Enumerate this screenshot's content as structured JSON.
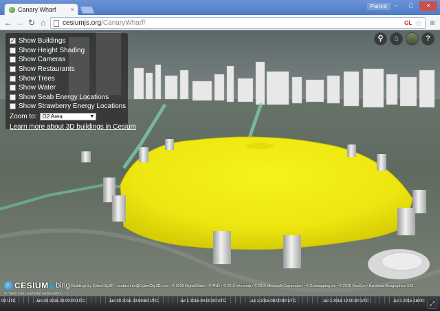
{
  "browser": {
    "tab_title": "Canary Wharf",
    "tab_close": "×",
    "user_name": "Patrick",
    "window_buttons": [
      "–",
      "□",
      "×"
    ],
    "back_glyph": "←",
    "forward_glyph": "→",
    "reload_glyph": "↻",
    "home_glyph": "⌂",
    "url_domain": "cesiumjs.org",
    "url_path": "/CanaryWharf/",
    "gl_badge": "GL",
    "star_glyph": "☆",
    "menu_glyph": "≡"
  },
  "panel": {
    "options": [
      {
        "label": "Show Buildings",
        "checked": true
      },
      {
        "label": "Show Height Shading",
        "checked": false
      },
      {
        "label": "Show Cameras",
        "checked": false
      },
      {
        "label": "Show Restaurants",
        "checked": false
      },
      {
        "label": "Show Trees",
        "checked": false
      },
      {
        "label": "Show Water",
        "checked": false
      },
      {
        "label": "Show Seab Energy Locations",
        "checked": false
      },
      {
        "label": "Show Strawberry Energy Locations",
        "checked": false
      }
    ],
    "zoom_label": "Zoom to:",
    "zoom_value": "O2 Area",
    "learn_more": "Learn more about 3D buildings in Cesium"
  },
  "tools": {
    "search_glyph": "⚲",
    "home_glyph": "⌂",
    "help_glyph": "?"
  },
  "credits": {
    "cesium": "CESIUM",
    "bing": "bing",
    "text": "Buildings by CyberCity3D - contact info@CyberCity3D.com • © 2015 DigitalGlobe • © AND • © 2015 Intermap • © 2015 Microsoft Corporation • © Getmapping plc • © 2015 GeoEye • Earthstar Geographics SIO",
    "line2": "© Harris Corp, Earthstar Geographics LLC"
  },
  "timeline": {
    "labels": [
      "00 UTC",
      "Jun 30 2015 20:00:00 UTC",
      "Jun 30 2015 23:59:60 UTC",
      "Jul 1 2015 04:00:00 UTC",
      "Jul 1 2015 08:00:00 UTC",
      "Jul 1 2015 12:00:00 UTC",
      "Jul 1 2015 16:00:"
    ],
    "fullscreen_glyph": "⤢"
  },
  "colors": {
    "dome": "#f2ee12",
    "panel_bg": "#2a2a2a",
    "sky": "#5e6a6a"
  }
}
